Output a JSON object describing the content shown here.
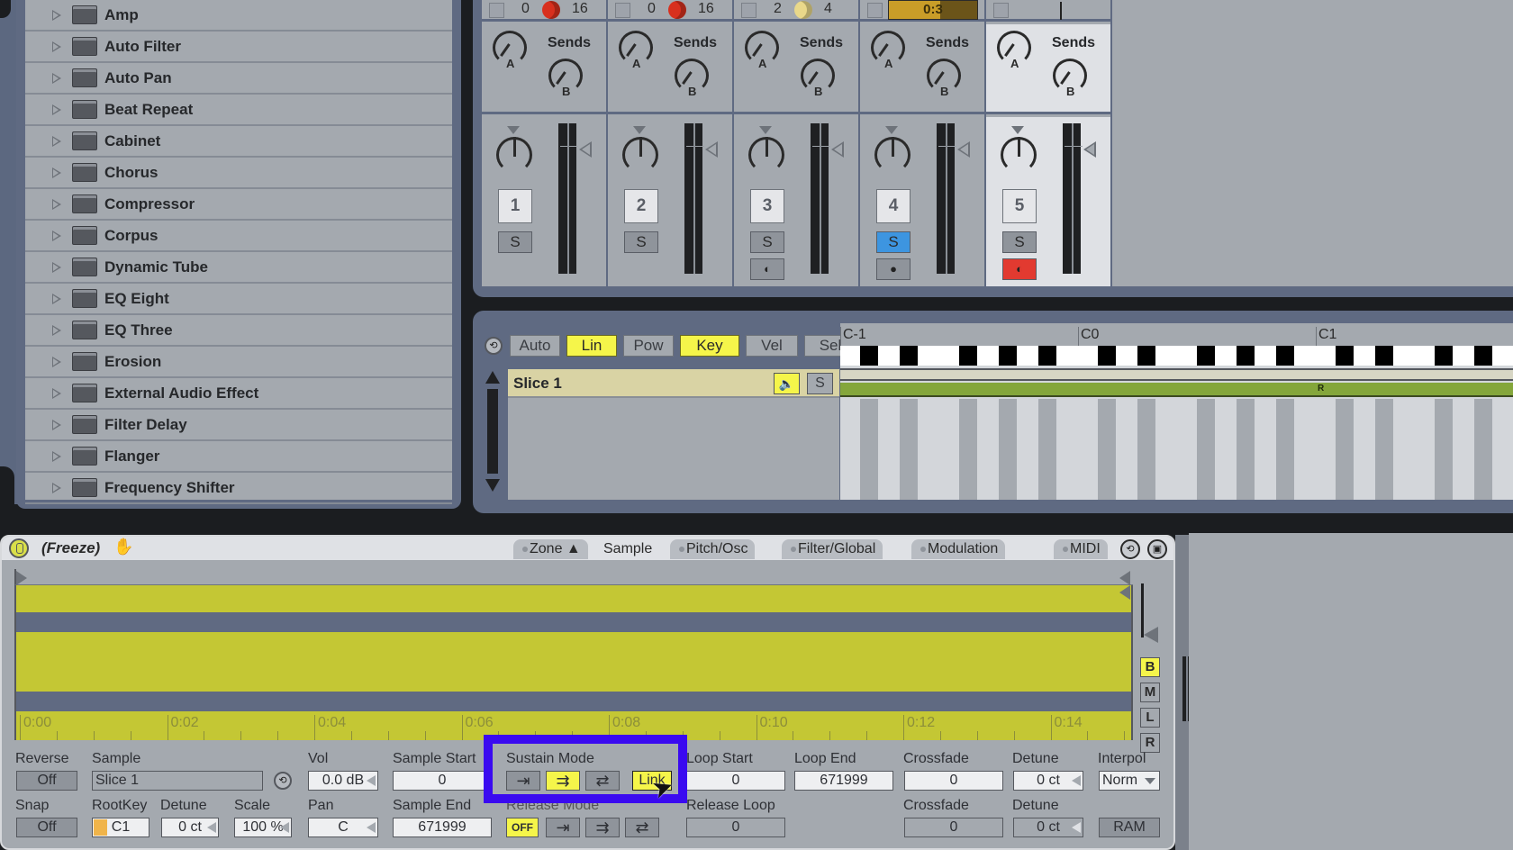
{
  "browser": {
    "items": [
      {
        "label": "Amp"
      },
      {
        "label": "Auto Filter"
      },
      {
        "label": "Auto Pan"
      },
      {
        "label": "Beat Repeat"
      },
      {
        "label": "Cabinet"
      },
      {
        "label": "Chorus"
      },
      {
        "label": "Compressor"
      },
      {
        "label": "Corpus"
      },
      {
        "label": "Dynamic Tube"
      },
      {
        "label": "EQ Eight"
      },
      {
        "label": "EQ Three"
      },
      {
        "label": "Erosion"
      },
      {
        "label": "External Audio Effect"
      },
      {
        "label": "Filter Delay"
      },
      {
        "label": "Flanger"
      },
      {
        "label": "Frequency Shifter"
      }
    ]
  },
  "mixer": {
    "sends_label": "Sends",
    "send_a": "A",
    "send_b": "B",
    "tracks": [
      {
        "clip_left": "0",
        "clip_right": "16",
        "pie_color": "#d8301e",
        "number": "1",
        "solo": "S",
        "solo_on": false,
        "arm": "",
        "selected": false
      },
      {
        "clip_left": "0",
        "clip_right": "16",
        "pie_color": "#d8301e",
        "number": "2",
        "solo": "S",
        "solo_on": false,
        "arm": "",
        "selected": false
      },
      {
        "clip_left": "2",
        "clip_right": "4",
        "pie_color": "#e9d88a",
        "number": "3",
        "solo": "S",
        "solo_on": false,
        "arm": "◐",
        "arm_on": false,
        "selected": false
      },
      {
        "clip_time": "0:3",
        "number": "4",
        "solo": "S",
        "solo_on": true,
        "arm": "●",
        "arm_on": false,
        "selected": false
      },
      {
        "number": "5",
        "solo": "S",
        "solo_on": false,
        "arm": "◐",
        "arm_on": true,
        "selected": true
      }
    ]
  },
  "slice_editor": {
    "toolbar": [
      {
        "label": "Auto",
        "on": false
      },
      {
        "label": "Lin",
        "on": true
      },
      {
        "label": "Pow",
        "on": false
      },
      {
        "label": "Key",
        "on": true
      },
      {
        "label": "Vel",
        "on": false
      },
      {
        "label": "Sel",
        "on": false
      }
    ],
    "slice_name": "Slice 1",
    "speaker_icon": "🔈",
    "solo_label": "S",
    "octaves": [
      "C-1",
      "C0",
      "C1"
    ],
    "note_bar_label": "R"
  },
  "device": {
    "title": "(Freeze)",
    "hand_icon": "✋",
    "tabs": [
      {
        "label": "Zone ▲",
        "active": false
      },
      {
        "label": "Sample",
        "active": true
      },
      {
        "label": "Pitch/Osc",
        "active": false
      },
      {
        "label": "Filter/Global",
        "active": false
      },
      {
        "label": "Modulation",
        "active": false
      },
      {
        "label": "MIDI",
        "active": false
      }
    ],
    "time_ruler": [
      "0:00",
      "0:02",
      "0:04",
      "0:06",
      "0:08",
      "0:10",
      "0:12",
      "0:14"
    ],
    "channel_buttons": [
      {
        "label": "B",
        "on": true
      },
      {
        "label": "M",
        "on": false
      },
      {
        "label": "L",
        "on": false
      },
      {
        "label": "R",
        "on": false
      }
    ],
    "params": {
      "reverse_label": "Reverse",
      "reverse_value": "Off",
      "snap_label": "Snap",
      "snap_value": "Off",
      "sample_label": "Sample",
      "sample_value": "Slice 1",
      "rootkey_label": "RootKey",
      "rootkey_value": "C1",
      "detune_label": "Detune",
      "detune_value": "0 ct",
      "scale_label": "Scale",
      "scale_value": "100 %",
      "vol_label": "Vol",
      "vol_value": "0.0 dB",
      "pan_label": "Pan",
      "pan_value": "C",
      "sample_start_label": "Sample Start",
      "sample_start_value": "0",
      "sample_end_label": "Sample End",
      "sample_end_value": "671999",
      "sustain_mode_label": "Sustain Mode",
      "sustain_buttons": [
        "⇥",
        "⇉",
        "⇄"
      ],
      "sustain_active_index": 1,
      "link_label": "Link",
      "release_mode_label": "Release Mode",
      "release_off_label": "OFF",
      "release_buttons": [
        "⇥",
        "⇉",
        "⇄"
      ],
      "loop_start_label": "Loop Start",
      "loop_start_value": "0",
      "loop_end_label": "Loop End",
      "loop_end_value": "671999",
      "release_loop_label": "Release Loop",
      "release_loop_value": "0",
      "crossfade_label": "Crossfade",
      "crossfade_value": "0",
      "crossfade2_label": "Crossfade",
      "crossfade2_value": "0",
      "loop_detune_label": "Detune",
      "loop_detune_value": "0 ct",
      "loop_detune2_label": "Detune",
      "loop_detune2_value": "0 ct",
      "interpol_label": "Interpol",
      "interpol_value": "Norm",
      "ram_label": "RAM"
    }
  },
  "colors": {
    "accent_yellow": "#f5f54a",
    "waveform": "#c4c734",
    "solo_blue": "#3d95e0",
    "arm_red": "#e23a30",
    "highlight": "#3a0af0"
  }
}
